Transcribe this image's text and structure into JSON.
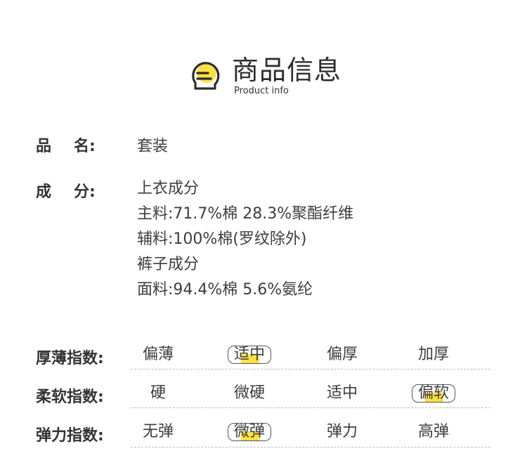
{
  "header": {
    "title": "商品信息",
    "subtitle": "Product info",
    "icon": "document-lines-icon",
    "accent_color": "#fce047"
  },
  "product": {
    "name_label_1": "品",
    "name_label_2": "名:",
    "name_value": "套装"
  },
  "composition": {
    "label_1": "成",
    "label_2": "分:",
    "lines": [
      "上衣成分",
      "主料:71.7%棉 28.3%聚酯纤维",
      "辅料:100%棉(罗纹除外)",
      "裤子成分",
      "面料:94.4%棉 5.6%氨纶"
    ]
  },
  "indices": [
    {
      "label": "厚薄指数:",
      "options": [
        "偏薄",
        "适中",
        "偏厚",
        "加厚"
      ],
      "selected_index": 1
    },
    {
      "label": "柔软指数:",
      "options": [
        "硬",
        "微硬",
        "适中",
        "偏软"
      ],
      "selected_index": 3
    },
    {
      "label": "弹力指数:",
      "options": [
        "无弹",
        "微弹",
        "弹力",
        "高弹"
      ],
      "selected_index": 1
    }
  ]
}
